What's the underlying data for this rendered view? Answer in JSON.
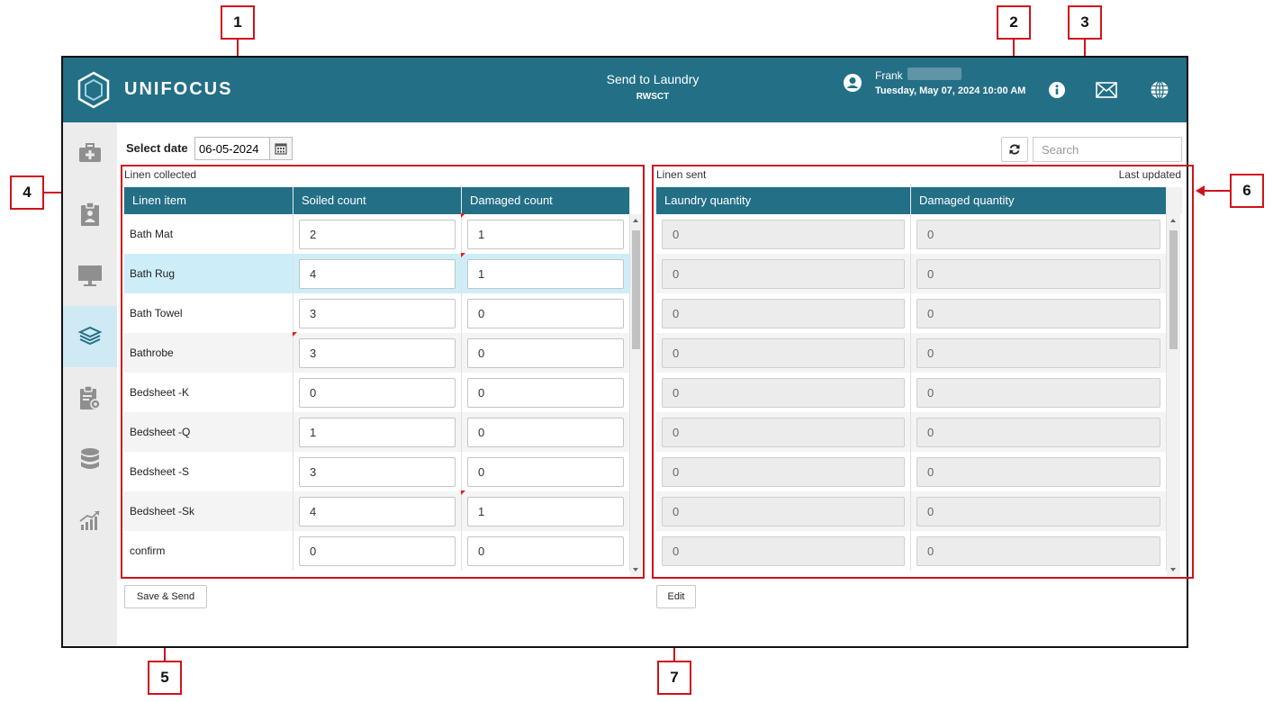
{
  "header": {
    "brand": "UNIFOCUS",
    "title": "Send to Laundry",
    "subtitle": "RWSCT",
    "user_name": "Frank",
    "datetime": "Tuesday, May 07, 2024 10:00 AM"
  },
  "toolbar": {
    "select_date_label": "Select date",
    "date_value": "06-05-2024",
    "search_placeholder": "Search"
  },
  "left_panel": {
    "section_label": "Linen collected",
    "columns": [
      "Linen item",
      "Soiled count",
      "Damaged count"
    ],
    "rows": [
      {
        "item": "Bath Mat",
        "soiled": "2",
        "damaged": "1"
      },
      {
        "item": "Bath Rug",
        "soiled": "4",
        "damaged": "1"
      },
      {
        "item": "Bath Towel",
        "soiled": "3",
        "damaged": "0"
      },
      {
        "item": "Bathrobe",
        "soiled": "3",
        "damaged": "0"
      },
      {
        "item": "Bedsheet -K",
        "soiled": "0",
        "damaged": "0"
      },
      {
        "item": "Bedsheet -Q",
        "soiled": "1",
        "damaged": "0"
      },
      {
        "item": "Bedsheet -S",
        "soiled": "3",
        "damaged": "0"
      },
      {
        "item": "Bedsheet -Sk",
        "soiled": "4",
        "damaged": "1"
      },
      {
        "item": "confirm",
        "soiled": "0",
        "damaged": "0"
      }
    ],
    "action_label": "Save & Send"
  },
  "right_panel": {
    "section_label": "Linen sent",
    "last_updated_label": "Last updated",
    "columns": [
      "Laundry quantity",
      "Damaged quantity"
    ],
    "rows": [
      {
        "laundry": "0",
        "damaged": "0"
      },
      {
        "laundry": "0",
        "damaged": "0"
      },
      {
        "laundry": "0",
        "damaged": "0"
      },
      {
        "laundry": "0",
        "damaged": "0"
      },
      {
        "laundry": "0",
        "damaged": "0"
      },
      {
        "laundry": "0",
        "damaged": "0"
      },
      {
        "laundry": "0",
        "damaged": "0"
      },
      {
        "laundry": "0",
        "damaged": "0"
      },
      {
        "laundry": "0",
        "damaged": "0"
      }
    ],
    "action_label": "Edit"
  },
  "callouts": [
    "1",
    "2",
    "3",
    "4",
    "5",
    "6",
    "7"
  ],
  "colors": {
    "header": "#236f86",
    "callout": "#d0121b",
    "selected_row": "#cdeef8"
  }
}
